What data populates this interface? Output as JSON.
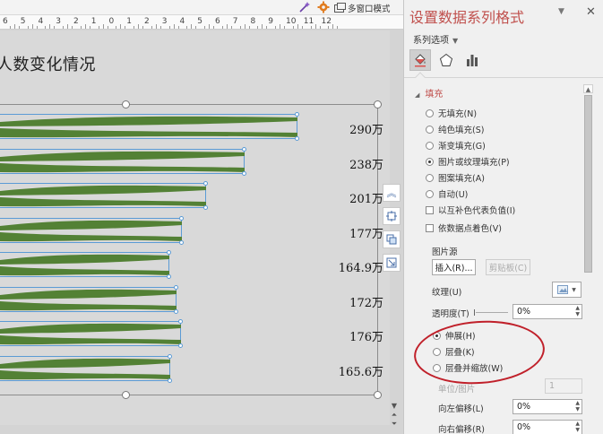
{
  "toolbar": {
    "multi_window_label": "多窗口模式",
    "icons": [
      "magic-wand-icon",
      "settings-gear-icon",
      "window-icon"
    ]
  },
  "ruler": {
    "numbers": [
      "6",
      "5",
      "4",
      "3",
      "2",
      "1",
      "0",
      "1",
      "2",
      "3",
      "4",
      "5",
      "6",
      "7",
      "8",
      "9",
      "10",
      "11",
      "12"
    ]
  },
  "slide": {
    "title": "人数变化情况",
    "bar_color": "#538135",
    "selection_color": "#5b9bd5"
  },
  "chart_data": {
    "type": "bar",
    "orientation": "horizontal",
    "categories": [
      "",
      "",
      "",
      "",
      "",
      "",
      "",
      ""
    ],
    "values": [
      290,
      238,
      201,
      177,
      164.9,
      172,
      176,
      165.6
    ],
    "data_labels": [
      "290万",
      "238万",
      "201万",
      "177万",
      "164.9万",
      "172万",
      "176万",
      "165.6万"
    ],
    "unit": "万",
    "fill": "picture",
    "title": "",
    "xlabel": "",
    "ylabel": ""
  },
  "float_tools": [
    "collapse-up-icon",
    "target-icon",
    "layers-icon",
    "resize-icon"
  ],
  "pane": {
    "title": "设置数据系列格式",
    "tab_label": "系列选项",
    "icons": [
      "paint-bucket-icon",
      "pentagon-icon",
      "bar-chart-icon"
    ],
    "fill_section": "填充",
    "fill_options": [
      {
        "label": "无填充(N)",
        "selected": false
      },
      {
        "label": "纯色填充(S)",
        "selected": false
      },
      {
        "label": "渐变填充(G)",
        "selected": false
      },
      {
        "label": "图片或纹理填充(P)",
        "selected": true
      },
      {
        "label": "图案填充(A)",
        "selected": false
      },
      {
        "label": "自动(U)",
        "selected": false
      }
    ],
    "checkbox_invert": "以互补色代表负值(I)",
    "checkbox_vary": "依数据点着色(V)",
    "picture_source_label": "图片源",
    "insert_button": "插入(R)...",
    "clipboard_button": "剪贴板(C)",
    "texture_label": "纹理(U)",
    "transparency_label": "透明度(T)",
    "transparency_value": "0%",
    "stretch_options": [
      {
        "label": "伸展(H)",
        "selected": true
      },
      {
        "label": "层叠(K)",
        "selected": false
      },
      {
        "label": "层叠并缩放(W)",
        "selected": false
      }
    ],
    "units_label": "单位/图片",
    "units_value": "1",
    "offset_left_label": "向左偏移(L)",
    "offset_left_value": "0%",
    "offset_right_label": "向右偏移(R)",
    "offset_right_value": "0%",
    "highlight_color": "#c0202a"
  }
}
